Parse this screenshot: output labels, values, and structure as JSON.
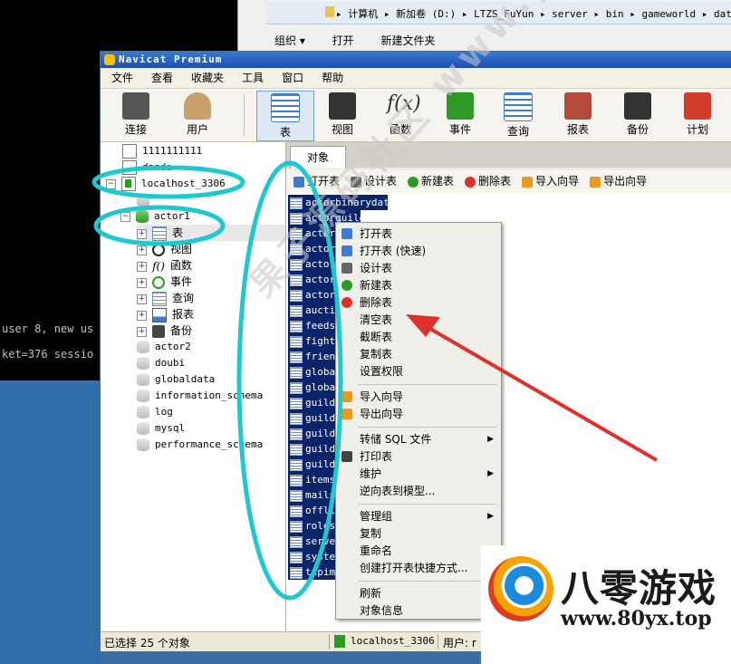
{
  "terminal": {
    "lines": [
      "user 8, new us",
      "ket=376 sessio"
    ]
  },
  "explorer": {
    "address_parts": [
      "计算机",
      "新加卷 (D:)",
      "LTZS_FuYun",
      "server",
      "bin",
      "gameworld",
      "data"
    ],
    "address_separator": "▸",
    "toolbar": {
      "organize": "组织 ▾",
      "open": "打开",
      "new_folder": "新建文件夹"
    }
  },
  "window": {
    "title": "Navicat Premium",
    "menu": [
      "文件",
      "查看",
      "收藏夹",
      "工具",
      "窗口",
      "帮助"
    ],
    "toolbar": [
      {
        "label": "连接",
        "icon": "plug-icon"
      },
      {
        "label": "用户",
        "icon": "user-icon"
      },
      {
        "label": "表",
        "icon": "table-icon"
      },
      {
        "label": "视图",
        "icon": "view-glasses-icon"
      },
      {
        "label": "函数",
        "icon": "function-icon"
      },
      {
        "label": "事件",
        "icon": "event-clock-icon"
      },
      {
        "label": "查询",
        "icon": "query-icon"
      },
      {
        "label": "报表",
        "icon": "report-icon"
      },
      {
        "label": "备份",
        "icon": "backup-tape-icon"
      },
      {
        "label": "计划",
        "icon": "calendar-icon"
      }
    ]
  },
  "tree": {
    "nodes": [
      {
        "label": "1111111111",
        "type": "connection"
      },
      {
        "label": "danda",
        "type": "connection"
      },
      {
        "label": "localhost_3306",
        "type": "connection-open"
      },
      {
        "label": "actor1",
        "type": "database-open"
      },
      {
        "label": "表",
        "type": "tables"
      },
      {
        "label": "视图",
        "type": "views"
      },
      {
        "label": "函数",
        "type": "functions"
      },
      {
        "label": "事件",
        "type": "events"
      },
      {
        "label": "查询",
        "type": "queries"
      },
      {
        "label": "报表",
        "type": "reports"
      },
      {
        "label": "备份",
        "type": "backups"
      },
      {
        "label": "actor2",
        "type": "database"
      },
      {
        "label": "doubi",
        "type": "database"
      },
      {
        "label": "globaldata",
        "type": "database"
      },
      {
        "label": "information_schema",
        "type": "database"
      },
      {
        "label": "log",
        "type": "database"
      },
      {
        "label": "mysql",
        "type": "database"
      },
      {
        "label": "performance_schema",
        "type": "database"
      }
    ]
  },
  "objects": {
    "tab": "对象",
    "toolbar": [
      "打开表",
      "设计表",
      "新建表",
      "删除表",
      "导入向导",
      "导出向导"
    ],
    "rows": [
      "actorbinarydata",
      "actorguild",
      "actorb",
      "actorc",
      "actord",
      "actors",
      "actorv",
      "auction",
      "feeds",
      "fight",
      "friends",
      "globalm",
      "globaly",
      "guildact",
      "guildli",
      "guildlt",
      "guildm",
      "guildsv",
      "items",
      "mails",
      "offline",
      "roles",
      "server",
      "system",
      "txpims"
    ]
  },
  "context_menu": {
    "items": [
      {
        "label": "打开表",
        "icon": true
      },
      {
        "label": "打开表 (快速)",
        "icon": true
      },
      {
        "label": "设计表",
        "icon": true
      },
      {
        "label": "新建表",
        "icon": true
      },
      {
        "label": "删除表",
        "icon": true
      },
      {
        "label": "清空表",
        "icon": false
      },
      {
        "label": "截断表",
        "icon": false
      },
      {
        "label": "复制表",
        "icon": false
      },
      {
        "label": "设置权限",
        "icon": false
      },
      {
        "sep": true
      },
      {
        "label": "导入向导",
        "icon": true
      },
      {
        "label": "导出向导",
        "icon": true
      },
      {
        "sep": true
      },
      {
        "label": "转储 SQL 文件",
        "icon": false,
        "submenu": true
      },
      {
        "label": "打印表",
        "icon": true
      },
      {
        "label": "维护",
        "icon": false,
        "submenu": true
      },
      {
        "label": "逆向表到模型...",
        "icon": false
      },
      {
        "sep": true
      },
      {
        "label": "管理组",
        "icon": false,
        "submenu": true
      },
      {
        "label": "复制",
        "icon": false
      },
      {
        "label": "重命名",
        "icon": false
      },
      {
        "label": "创建打开表快捷方式...",
        "icon": false
      },
      {
        "sep": true
      },
      {
        "label": "刷新",
        "icon": false
      },
      {
        "label": "对象信息",
        "icon": false
      }
    ]
  },
  "statusbar": {
    "selected": "已选择 25 个对象",
    "connection": "localhost_3306",
    "user": "用户: r"
  },
  "watermark": "果子源码社区 www.guo.cc",
  "logo": {
    "name": "八零游戏",
    "url": "www.80yx.top"
  },
  "colors": {
    "annotation": "#1ec8d0",
    "arrow": "#e0302a",
    "selection": "#0a246a"
  }
}
